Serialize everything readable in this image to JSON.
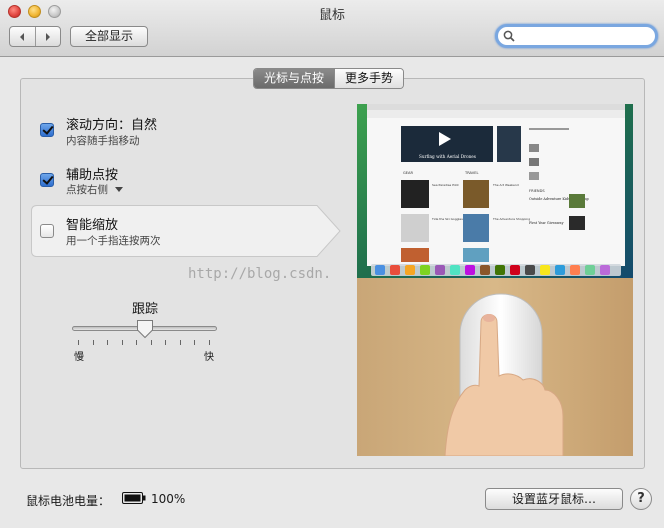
{
  "window": {
    "title": "鼠标"
  },
  "toolbar": {
    "back_icon": "chevron-left-icon",
    "forward_icon": "chevron-right-icon",
    "show_all_label": "全部显示",
    "search": {
      "value": "",
      "placeholder": ""
    }
  },
  "tabs": [
    {
      "label": "光标与点按",
      "active": true
    },
    {
      "label": "更多手势",
      "active": false
    }
  ],
  "options": [
    {
      "title": "滚动方向：自然",
      "subtitle": "内容随手指移动",
      "checked": true
    },
    {
      "title": "辅助点按",
      "subtitle": "点按右侧",
      "checked": true
    },
    {
      "title": "智能缩放",
      "subtitle": "用一个手指连按两次",
      "checked": false
    }
  ],
  "tracking": {
    "label": "跟踪",
    "min_label": "慢",
    "max_label": "快",
    "level": 0.5
  },
  "watermark": "http://blog.csdn.",
  "preview": {
    "site_headlines": [
      "Surfing with Aerial Drones",
      "GEAR",
      "TRAVEL",
      "FRIENDS",
      "Outside Adventure Kids Day Camp",
      "First Year Giveaway"
    ],
    "section_labels": [
      "Sea Paradise Pilot",
      "The Art Weekend",
      "Tide the Ski Goggles",
      "The Adventure Shopping"
    ]
  },
  "footer": {
    "battery_label": "鼠标电池电量：",
    "battery_icon": "battery-icon",
    "battery_value": "100%",
    "bluetooth_button": "设置蓝牙鼠标…",
    "help_label": "?"
  },
  "colors": {
    "accent": "#3a7bd5",
    "tab_active": "#7a7a7a"
  }
}
